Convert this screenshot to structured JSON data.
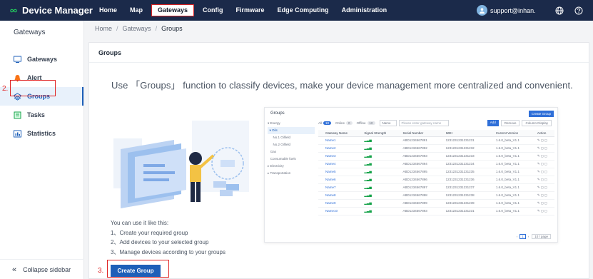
{
  "app": {
    "title": "Device Manager"
  },
  "nav": {
    "items": [
      "Home",
      "Map",
      "Gateways",
      "Config",
      "Firmware",
      "Edge Computing",
      "Administration"
    ],
    "active": "Gateways",
    "user": "support@inhan..."
  },
  "sidebar": {
    "title": "Gateways",
    "items": [
      {
        "label": "Gateways",
        "icon": "gateway-icon"
      },
      {
        "label": "Alert",
        "icon": "alert-icon"
      },
      {
        "label": "Groups",
        "icon": "groups-icon"
      },
      {
        "label": "Tasks",
        "icon": "tasks-icon"
      },
      {
        "label": "Statistics",
        "icon": "statistics-icon"
      }
    ],
    "active": "Groups",
    "collapse_label": "Collapse sidebar"
  },
  "annotations": {
    "step2": "2.",
    "step3": "3."
  },
  "breadcrumb": [
    "Home",
    "Gateways",
    "Groups"
  ],
  "panel": {
    "title": "Groups",
    "headline": "Use 「Groups」 function to classify devices, make your device management more centralized and convenient.",
    "usage_intro": "You can use it like this:",
    "usage_steps": [
      "1、Create your required group",
      "2、Add devices to your selected group",
      "3、Manage devices according to your groups"
    ],
    "create_button": "Create Group"
  },
  "preview": {
    "title": "Groups",
    "create_button": "Create Group",
    "tree": [
      "Energy",
      "Oils",
      "No.1 Oilfield",
      "No.2 Oilfield",
      "Gas",
      "Consumable fuels",
      "Electricity",
      "Transportation"
    ],
    "tabs": [
      {
        "label": "All",
        "count": "10"
      },
      {
        "label": "Online",
        "count": "0"
      },
      {
        "label": "Offline",
        "count": "10"
      }
    ],
    "filter": "Name",
    "search_placeholder": "Please enter gateway name",
    "add_button": "Add",
    "remove_button": "Remove",
    "column_button": "Column Display",
    "columns": [
      "Gateway Name",
      "Signal Strength",
      "Serial Number",
      "IMEI",
      "Current Version",
      "Action"
    ],
    "rows": [
      [
        "Name1",
        "ABD1234567891",
        "1231231231231231",
        "1.6.0_beta_V1.1"
      ],
      [
        "Name2",
        "ABD1234567892",
        "1231231231231232",
        "1.6.0_beta_V1.1"
      ],
      [
        "Name3",
        "ABD1234567893",
        "1231231231231233",
        "1.6.0_beta_V1.1"
      ],
      [
        "Name4",
        "ABD1234567894",
        "1231231231231234",
        "1.6.0_beta_V1.1"
      ],
      [
        "Name5",
        "ABD1234567895",
        "1231231231231235",
        "1.6.0_beta_V1.1"
      ],
      [
        "Name6",
        "ABD1234567896",
        "1231231231231236",
        "1.6.0_beta_V1.1"
      ],
      [
        "Name7",
        "ABD1234567897",
        "1231231231231237",
        "1.6.0_beta_V1.1"
      ],
      [
        "Name8",
        "ABD1234567898",
        "1231231231231238",
        "1.6.0_beta_V1.1"
      ],
      [
        "Name9",
        "ABD1234567899",
        "1231231231231239",
        "1.6.0_beta_V1.1"
      ],
      [
        "Name10",
        "ABD1234567893",
        "1231231231231231",
        "1.6.0_beta_V1.1"
      ]
    ],
    "page": "1",
    "per_page": "10 / page"
  },
  "colors": {
    "nav_bg": "#1b2a4a",
    "accent": "#1d5fb8",
    "annotation": "#e02424"
  }
}
